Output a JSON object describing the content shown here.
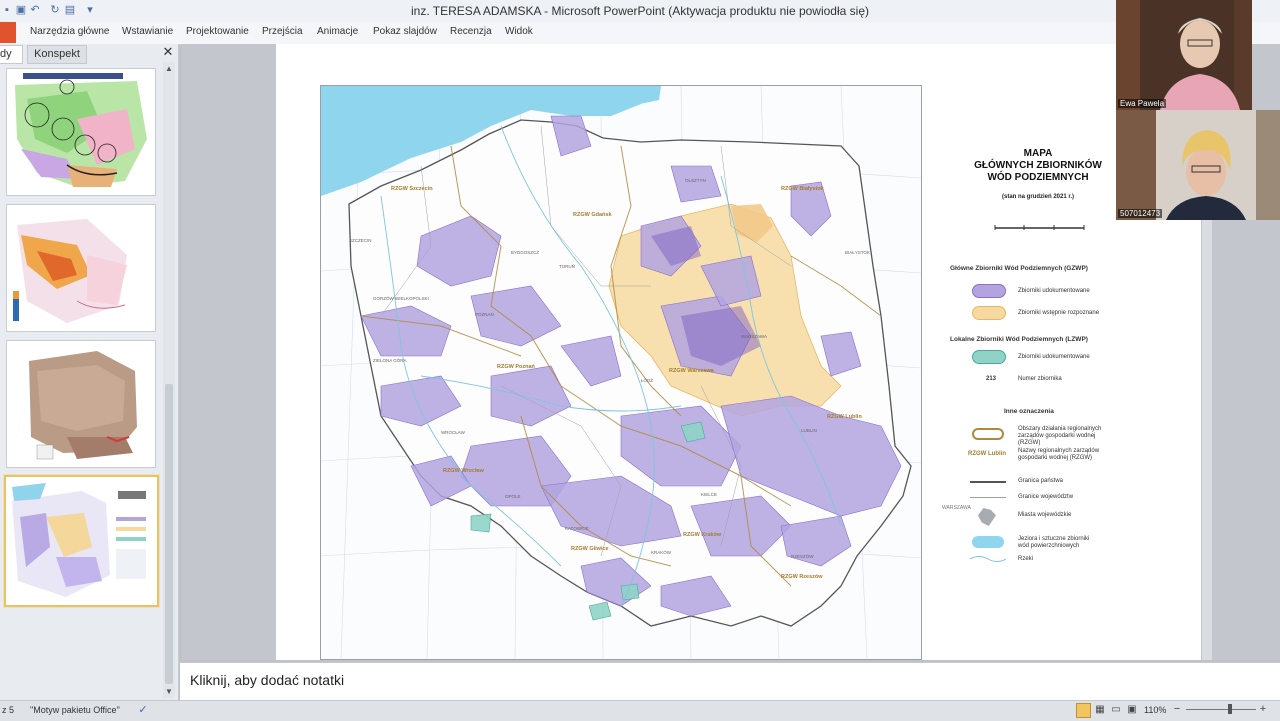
{
  "app": {
    "title": "inz. TERESA ADAMSKA  -  Microsoft PowerPoint (Aktywacja produktu nie powiodła się)"
  },
  "ribbon": {
    "tabs": [
      "Narzędzia główne",
      "Wstawianie",
      "Projektowanie",
      "Przejścia",
      "Animacje",
      "Pokaz slajdów",
      "Recenzja",
      "Widok"
    ]
  },
  "left_panel": {
    "tab_slides": "dy",
    "tab_outline": "Konspekt",
    "close": "✕"
  },
  "map": {
    "title_lines": [
      "MAPA",
      "GŁÓWNYCH ZBIORNIKÓW",
      "WÓD PODZIEMNYCH"
    ],
    "subtitle": "(stan na grudzień 2021 r.)",
    "legend": {
      "gzwp_heading": "Główne Zbiorniki Wód Podziemnych (GZWP)",
      "gzwp_documented": "Zbiorniki udokumentowane",
      "gzwp_preliminary": "Zbiorniki wstępnie rozpoznane",
      "lzwp_heading": "Lokalne Zbiorniki Wód Podziemnych (LZWP)",
      "lzwp_documented": "Zbiorniki udokumentowane",
      "number_marker": "213",
      "number_label": "Numer zbiornika",
      "other_heading": "Inne oznaczenia",
      "rzgw_area": "Obszary działania regionalnych zarządów gospodarki wodnej (RZGW)",
      "rzgw_name_sample": "RZGW Lublin",
      "rzgw_name": "Nazwy regionalnych zarządów gospodarki wodnej (RZGW)",
      "state_border": "Granica państwa",
      "voivodeship_border": "Granice województw",
      "city_sample": "WARSZAWA",
      "cities": "Miasta wojewódzkie",
      "lakes": "Jeziora i sztuczne zbiorniki wód powierzchniowych",
      "rivers": "Rzeki"
    },
    "rzgw_labels": [
      "RZGW Szczecin",
      "RZGW Gdańsk",
      "RZGW Białystok",
      "RZGW Poznań",
      "RZGW Warszawa",
      "RZGW Lublin",
      "RZGW Wrocław",
      "RZGW Gliwice",
      "RZGW Kraków",
      "RZGW Rzeszów"
    ],
    "city_labels": [
      "SZCZECIN",
      "BYDGOSZCZ",
      "TORUŃ",
      "BIAŁYSTOK",
      "GORZÓW WIELKOPOLSKI",
      "POZNAŃ",
      "ZIELONA GÓRA",
      "WARSZAWA",
      "ŁÓDŹ",
      "LUBLIN",
      "WROCŁAW",
      "OPOLE",
      "KATOWICE",
      "KIELCE",
      "KRAKÓW",
      "RZESZÓW",
      "OLSZTYN"
    ]
  },
  "participants": [
    {
      "name": "Ewa Pawela"
    },
    {
      "name": "507012473"
    }
  ],
  "notes": {
    "placeholder": "Kliknij, aby dodać notatki"
  },
  "status": {
    "slide_info": "z 5",
    "theme": "\"Motyw pakietu Office\"",
    "zoom": "110%"
  },
  "colors": {
    "gzwp_documented": "#b3a4e0",
    "gzwp_preliminary": "#f7d9a0",
    "lzwp_documented": "#8fd3c6",
    "rzgw_border": "#b08a3c",
    "sea": "#7fd0ec",
    "ribbon_file": "#e1532d"
  }
}
